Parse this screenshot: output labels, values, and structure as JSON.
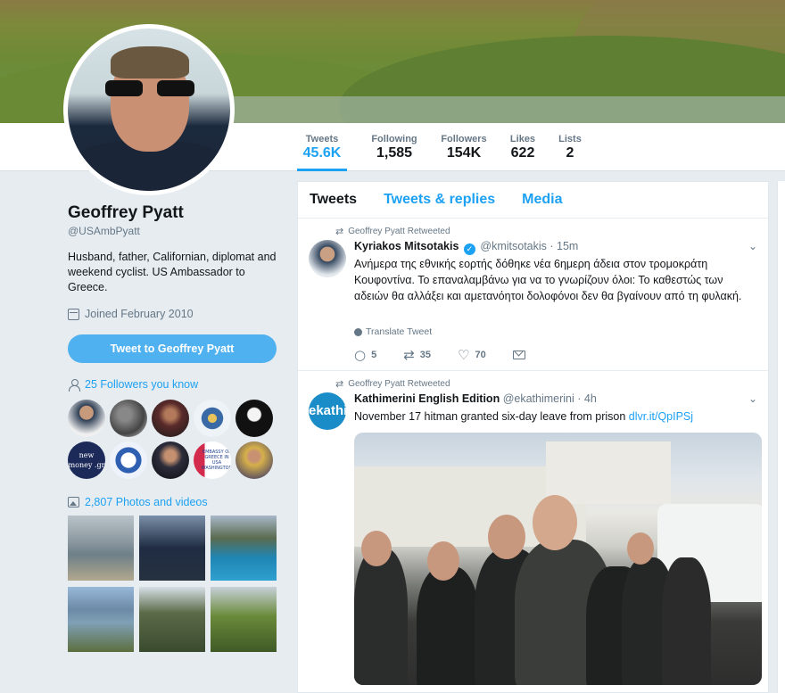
{
  "profile": {
    "name": "Geoffrey Pyatt",
    "handle": "@USAmbPyatt",
    "bio": "Husband, father, Californian, diplomat and weekend cyclist. US Ambassador to Greece.",
    "joined": "Joined February 2010",
    "tweet_to_label": "Tweet to Geoffrey Pyatt",
    "followers_you_know": "25 Followers you know",
    "photos_videos": "2,807 Photos and videos",
    "follower_avatar_texts": [
      "new money .gr",
      "EMBASSY OF GREECE IN USA WASHINGTON"
    ]
  },
  "stats": [
    {
      "label": "Tweets",
      "value": "45.6K"
    },
    {
      "label": "Following",
      "value": "1,585"
    },
    {
      "label": "Followers",
      "value": "154K"
    },
    {
      "label": "Likes",
      "value": "622"
    },
    {
      "label": "Lists",
      "value": "2"
    }
  ],
  "timeline": {
    "tabs": [
      "Tweets",
      "Tweets & replies",
      "Media"
    ],
    "tweets": [
      {
        "retweeted_by": "Geoffrey Pyatt Retweeted",
        "author": "Kyriakos Mitsotakis",
        "username": "@kmitsotakis",
        "time": "15m",
        "text": "Ανήμερα της εθνικής εορτής δόθηκε  νέα 6ημερη άδεια στον τρομοκράτη Κουφοντίνα. Το επαναλαμβάνω για να το γνωρίζουν όλοι: Το καθεστώς των αδειών θα αλλάξει και αμετανόητοι δολοφόνοι δεν θα βγαίνουν από τη φυλακή.",
        "translate": "Translate Tweet",
        "replies": "5",
        "retweets": "35",
        "likes": "70"
      },
      {
        "retweeted_by": "Geoffrey Pyatt Retweeted",
        "author": "Kathimerini English Edition",
        "username": "@ekathimerini",
        "time": "4h",
        "text": "November 17 hitman granted six-day leave from prison",
        "link": "dlvr.it/QpIPSj",
        "avatar_text": "ekathi"
      }
    ]
  },
  "icons": {
    "retweet": "retweet-icon",
    "reply": "reply-icon",
    "like": "heart-icon",
    "message": "envelope-icon",
    "verified": "verified-badge-icon",
    "calendar": "calendar-icon",
    "people": "people-icon",
    "photo": "photo-icon",
    "globe": "globe-icon"
  },
  "colors": {
    "accent": "#1da1f2",
    "background": "#e6ecf0",
    "muted": "#657786"
  }
}
